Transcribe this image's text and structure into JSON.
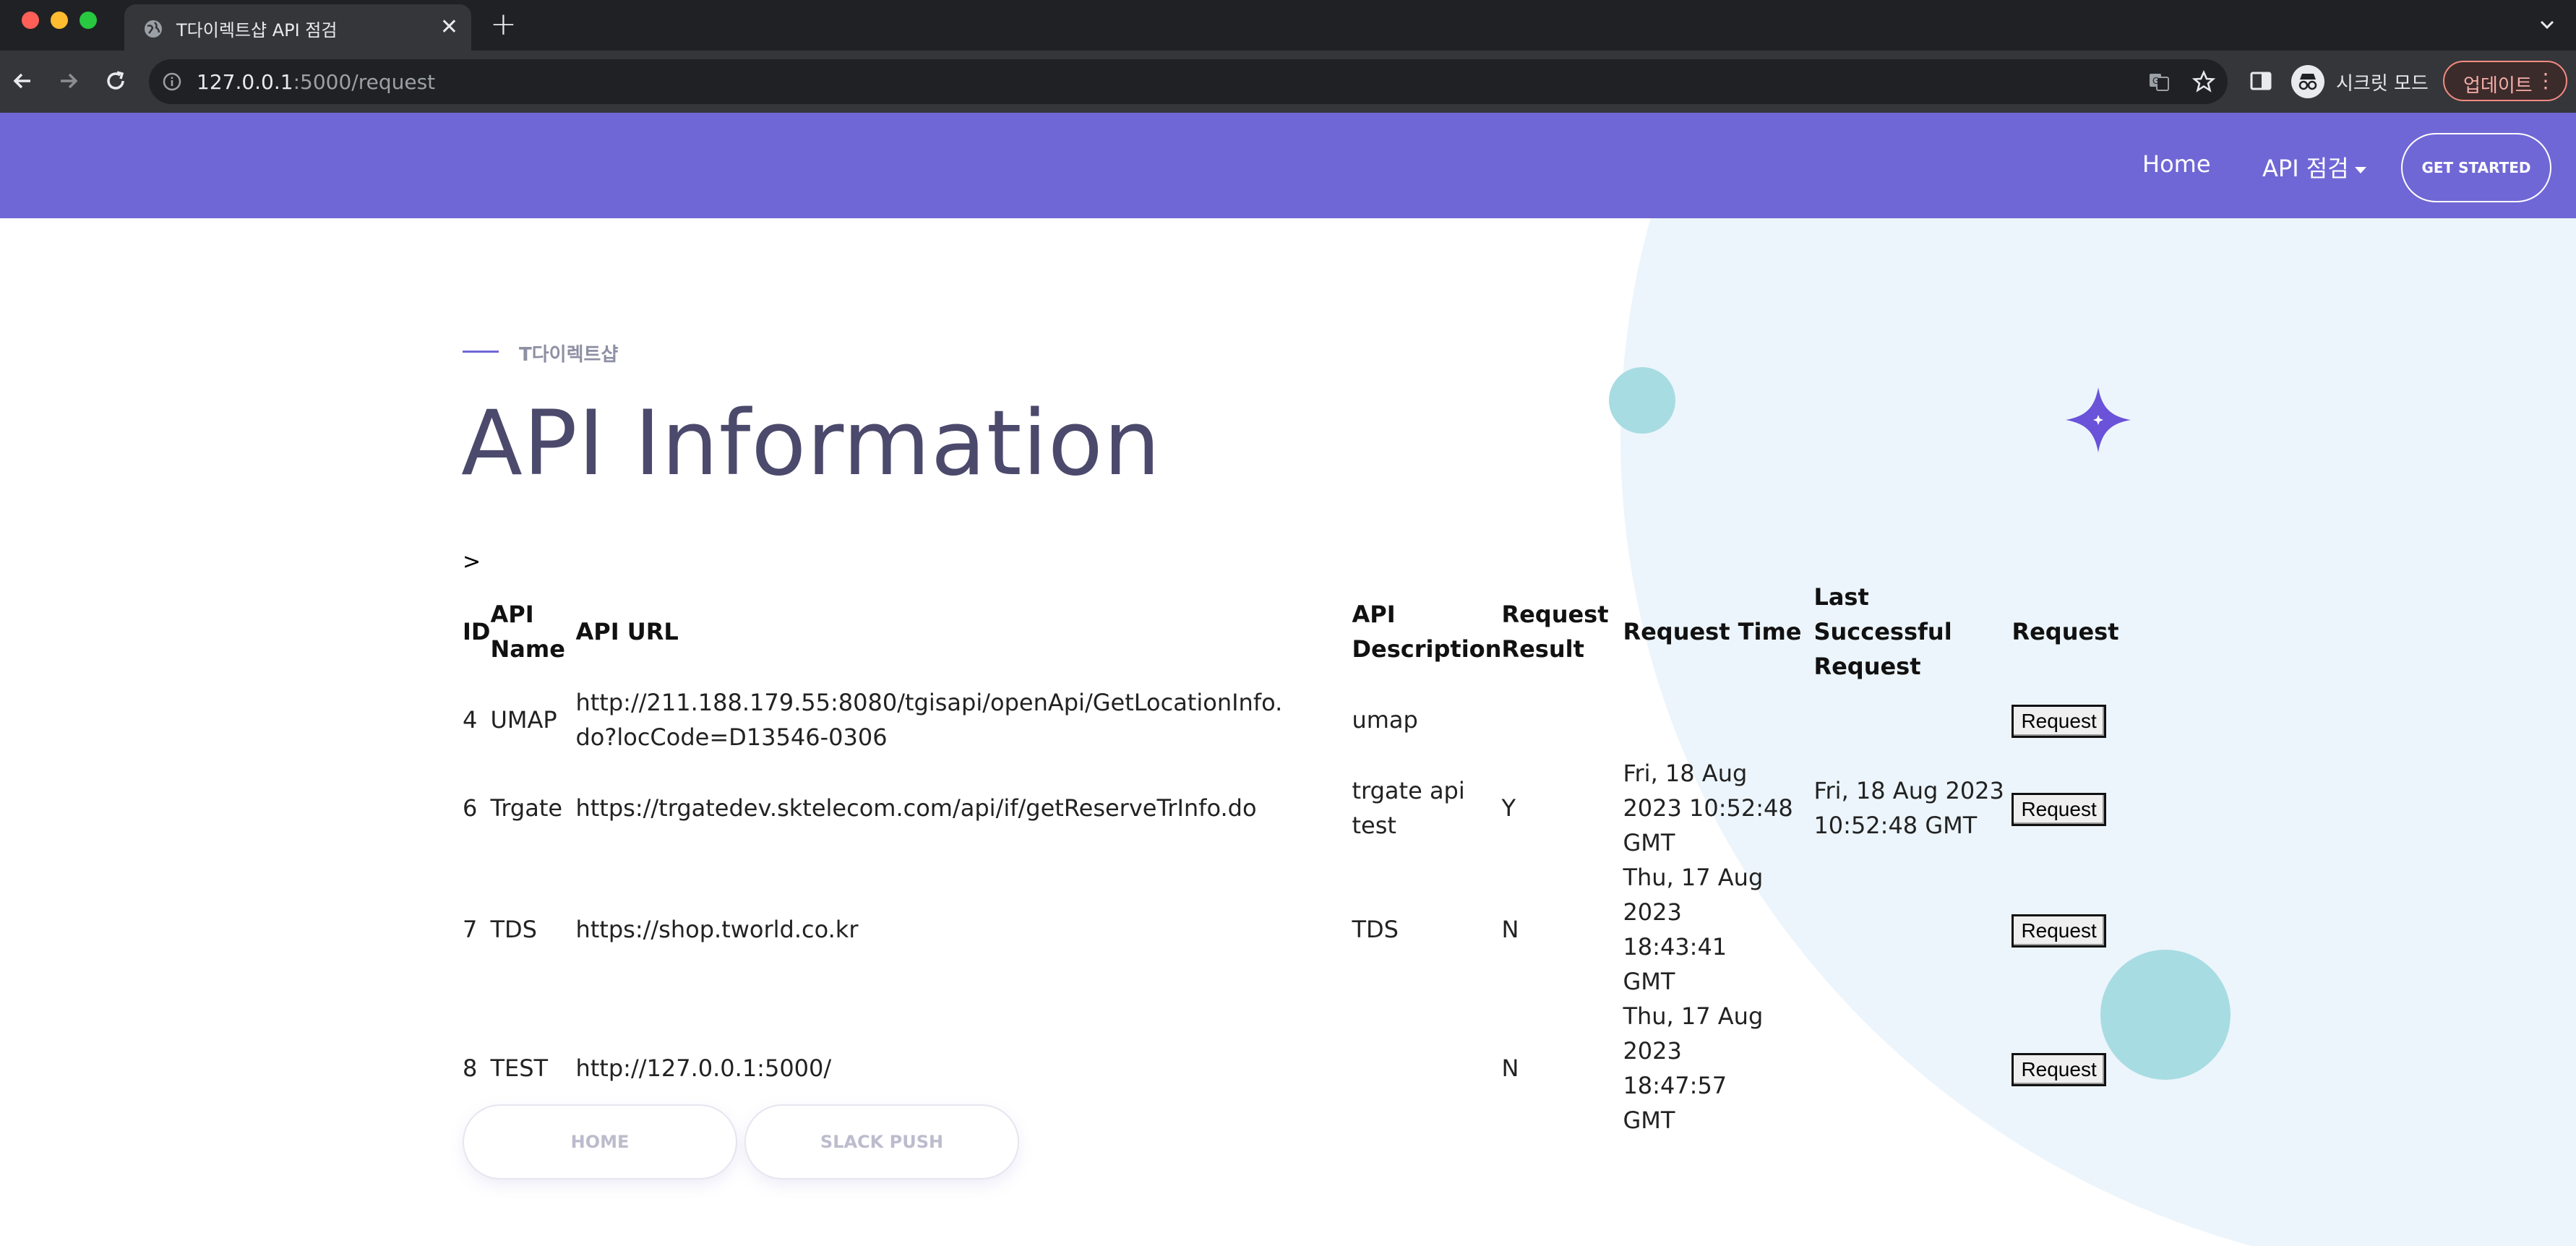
{
  "browser": {
    "tab_title": "T다이렉트샵 API 점검",
    "url_host": "127.0.0.1",
    "url_rest": ":5000/request",
    "incognito_label": "시크릿 모드",
    "update_label": "업데이트"
  },
  "site_nav": {
    "home": "Home",
    "api_menu": "API 점검",
    "cta": "GET STARTED"
  },
  "hero": {
    "eyebrow": "T다이렉트샵",
    "title": "API Information",
    "prompt_glyph": ">"
  },
  "table": {
    "headers": {
      "id": "ID",
      "name": "API Name",
      "url": "API URL",
      "desc": "API Description",
      "result": "Request Result",
      "time": "Request Time",
      "last": "Last Successful Request",
      "req": "Request"
    },
    "rows": [
      {
        "id": "4",
        "name": "UMAP",
        "url": "http://211.188.179.55:8080/tgisapi/openApi/GetLocationInfo.do?locCode=D13546-0306",
        "desc": "umap",
        "result": "",
        "time": "",
        "last": "",
        "button": "Request"
      },
      {
        "id": "6",
        "name": "Trgate",
        "url": "https://trgatedev.sktelecom.com/api/if/getReserveTrInfo.do",
        "desc": "trgate api test",
        "result": "Y",
        "time": "Fri, 18 Aug 2023 10:52:48 GMT",
        "last": "Fri, 18 Aug 2023 10:52:48 GMT",
        "button": "Request"
      },
      {
        "id": "7",
        "name": "TDS",
        "url": "https://shop.tworld.co.kr",
        "desc": "TDS",
        "result": "N",
        "time": "Thu, 17 Aug 2023 18:43:41 GMT",
        "last": "",
        "button": "Request"
      },
      {
        "id": "8",
        "name": "TEST",
        "url": "http://127.0.0.1:5000/",
        "desc": "",
        "result": "N",
        "time": "Thu, 17 Aug 2023 18:47:57 GMT",
        "last": "",
        "button": "Request"
      }
    ]
  },
  "buttons": {
    "home": "HOME",
    "slack": "SLACK PUSH"
  },
  "colors": {
    "header_bg": "#7067d6",
    "title": "#4b4a6c",
    "accent_circle": "#a7dce2",
    "bg_blob": "#ecf5fb"
  }
}
